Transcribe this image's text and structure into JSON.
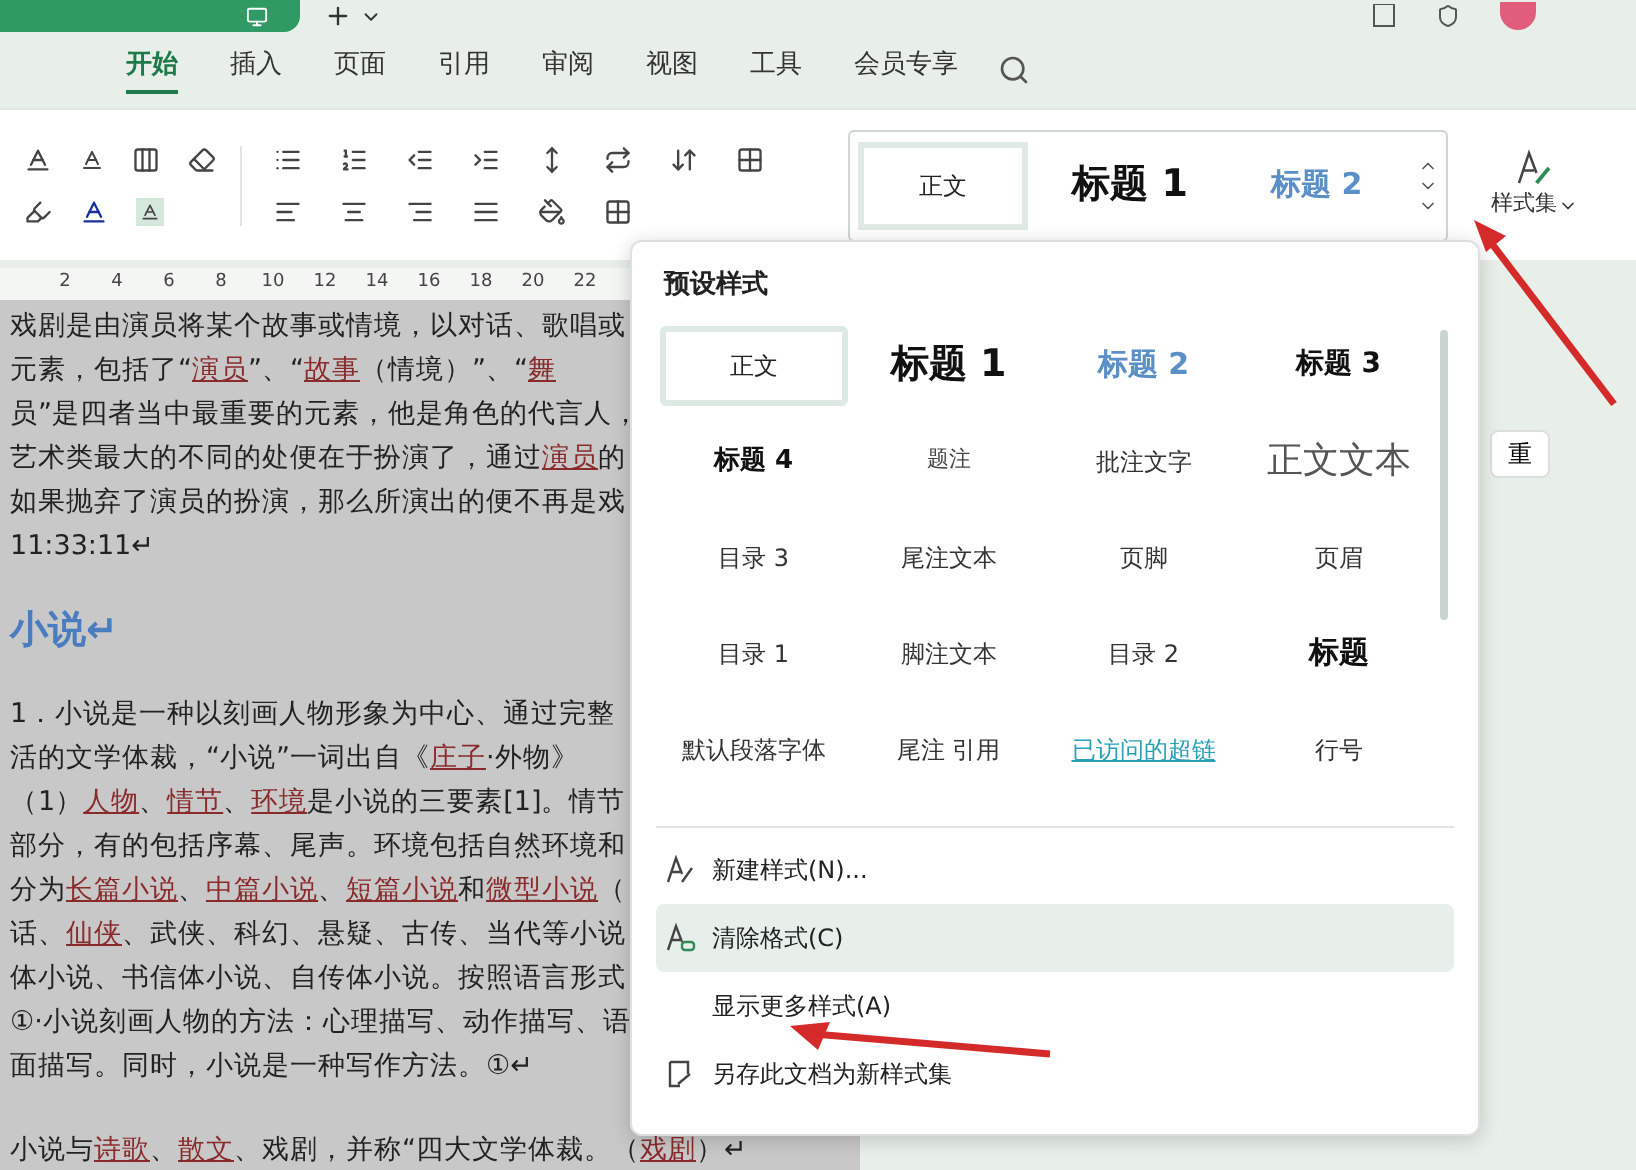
{
  "tabs": [
    {
      "label": "开始",
      "selected": true
    },
    {
      "label": "插入",
      "selected": false
    },
    {
      "label": "页面",
      "selected": false
    },
    {
      "label": "引用",
      "selected": false
    },
    {
      "label": "审阅",
      "selected": false
    },
    {
      "label": "视图",
      "selected": false
    },
    {
      "label": "工具",
      "selected": false
    },
    {
      "label": "会员专享",
      "selected": false
    }
  ],
  "gallery": [
    {
      "label": "正文",
      "kind": "body",
      "selected": true
    },
    {
      "label": "标题 1",
      "kind": "h1",
      "selected": false
    },
    {
      "label": "标题 2",
      "kind": "h2",
      "selected": false
    }
  ],
  "style_set_button": "样式集",
  "ruler": [
    "2",
    "4",
    "6",
    "8",
    "10",
    "12",
    "14",
    "16",
    "18",
    "20",
    "22"
  ],
  "side_button": "重",
  "document": [
    {
      "kind": "line",
      "segments": [
        {
          "text": "戏剧是由演员将某个故事或情境，以对话、歌唱或",
          "link": false
        }
      ]
    },
    {
      "kind": "line",
      "segments": [
        {
          "text": "元素，包括了“",
          "link": false
        },
        {
          "text": "演员",
          "link": true
        },
        {
          "text": "”、“",
          "link": false
        },
        {
          "text": "故事",
          "link": true
        },
        {
          "text": "（情境）”、“",
          "link": false
        },
        {
          "text": "舞",
          "link": true
        }
      ]
    },
    {
      "kind": "line",
      "segments": [
        {
          "text": "员”是四者当中最重要的元素，他是角色的代言人，",
          "link": false
        }
      ]
    },
    {
      "kind": "line",
      "segments": [
        {
          "text": "艺术类最大的不同的处便在于扮演了，通过",
          "link": false
        },
        {
          "text": "演员",
          "link": true
        },
        {
          "text": "的",
          "link": false
        }
      ]
    },
    {
      "kind": "line",
      "segments": [
        {
          "text": "如果抛弃了演员的扮演，那么所演出的便不再是戏",
          "link": false
        }
      ]
    },
    {
      "kind": "short",
      "segments": [
        {
          "text": "11:33:11↵",
          "link": false
        }
      ]
    },
    {
      "kind": "heading",
      "segments": [
        {
          "text": "小说",
          "link": false
        },
        {
          "text": "↵",
          "link": false
        }
      ]
    },
    {
      "kind": "line",
      "segments": [
        {
          "text": "1．小说是一种以刻画人物形象为中心、通过完整",
          "link": false
        }
      ]
    },
    {
      "kind": "line",
      "segments": [
        {
          "text": "活的文学体裁，“小说”一词出自《",
          "link": false
        },
        {
          "text": "庄子",
          "link": true
        },
        {
          "text": "·外物》",
          "link": false
        }
      ]
    },
    {
      "kind": "line",
      "segments": [
        {
          "text": "（1）",
          "link": false
        },
        {
          "text": "人物",
          "link": true
        },
        {
          "text": "、",
          "link": false
        },
        {
          "text": "情节",
          "link": true
        },
        {
          "text": "、",
          "link": false
        },
        {
          "text": "环境",
          "link": true
        },
        {
          "text": "是小说的三要素[1]。情节",
          "link": false
        }
      ]
    },
    {
      "kind": "line",
      "segments": [
        {
          "text": "部分，有的包括序幕、尾声。环境包括自然环境和",
          "link": false
        }
      ]
    },
    {
      "kind": "line",
      "segments": [
        {
          "text": "分为",
          "link": false
        },
        {
          "text": "长篇小说",
          "link": true
        },
        {
          "text": "、",
          "link": false
        },
        {
          "text": "中篇小说",
          "link": true
        },
        {
          "text": "、",
          "link": false
        },
        {
          "text": "短篇小说",
          "link": true
        },
        {
          "text": "和",
          "link": false
        },
        {
          "text": "微型小说",
          "link": true
        },
        {
          "text": "（",
          "link": false
        }
      ]
    },
    {
      "kind": "line",
      "segments": [
        {
          "text": "话、",
          "link": false
        },
        {
          "text": "仙侠",
          "link": true
        },
        {
          "text": "、武侠、科幻、悬疑、古传、当代等小说",
          "link": false
        }
      ]
    },
    {
      "kind": "line",
      "segments": [
        {
          "text": "体小说、书信体小说、自传体小说。按照语言形式",
          "link": false
        }
      ]
    },
    {
      "kind": "line",
      "segments": [
        {
          "text": "①·小说刻画人物的方法：心理描写、动作描写、语",
          "link": false
        }
      ]
    },
    {
      "kind": "short",
      "segments": [
        {
          "text": "面描写。同时，小说是一种写作方法。①↵",
          "link": false
        }
      ]
    },
    {
      "kind": "gap"
    },
    {
      "kind": "line",
      "segments": [
        {
          "text": "小说与",
          "link": false
        },
        {
          "text": "诗歌",
          "link": true
        },
        {
          "text": "、",
          "link": false
        },
        {
          "text": "散文",
          "link": true
        },
        {
          "text": "、戏剧，并称“四大文学体裁。（",
          "link": false
        },
        {
          "text": "戏剧",
          "link": true
        },
        {
          "text": "）↵",
          "link": false
        }
      ]
    }
  ],
  "popup": {
    "title": "预设样式",
    "styles": [
      {
        "label": "正文",
        "kind": "body",
        "selected": true
      },
      {
        "label": "标题 1",
        "kind": "h1",
        "selected": false
      },
      {
        "label": "标题 2",
        "kind": "h2",
        "selected": false
      },
      {
        "label": "标题 3",
        "kind": "h3",
        "selected": false
      },
      {
        "label": "标题 4",
        "kind": "h4",
        "selected": false
      },
      {
        "label": "题注",
        "kind": "small",
        "selected": false
      },
      {
        "label": "批注文字",
        "kind": "normal",
        "selected": false
      },
      {
        "label": "正文文本",
        "kind": "serif",
        "selected": false
      },
      {
        "label": "目录 3",
        "kind": "normal",
        "selected": false
      },
      {
        "label": "尾注文本",
        "kind": "normal",
        "selected": false
      },
      {
        "label": "页脚",
        "kind": "normal",
        "selected": false
      },
      {
        "label": "页眉",
        "kind": "normal",
        "selected": false
      },
      {
        "label": "目录 1",
        "kind": "normal",
        "selected": false
      },
      {
        "label": "脚注文本",
        "kind": "normal",
        "selected": false
      },
      {
        "label": "目录 2",
        "kind": "normal",
        "selected": false
      },
      {
        "label": "标题",
        "kind": "title",
        "selected": false
      },
      {
        "label": "默认段落字体",
        "kind": "normal",
        "selected": false
      },
      {
        "label": "尾注 引用",
        "kind": "normal",
        "selected": false
      },
      {
        "label": "已访问的超链",
        "kind": "link",
        "selected": false
      },
      {
        "label": "行号",
        "kind": "normal",
        "selected": false
      }
    ],
    "menu": [
      {
        "label": "新建样式(N)...",
        "selected": false
      },
      {
        "label": "清除格式(C)",
        "selected": true
      },
      {
        "label": "显示更多样式(A)",
        "selected": false
      },
      {
        "label": "另存此文档为新样式集",
        "selected": false
      }
    ]
  }
}
